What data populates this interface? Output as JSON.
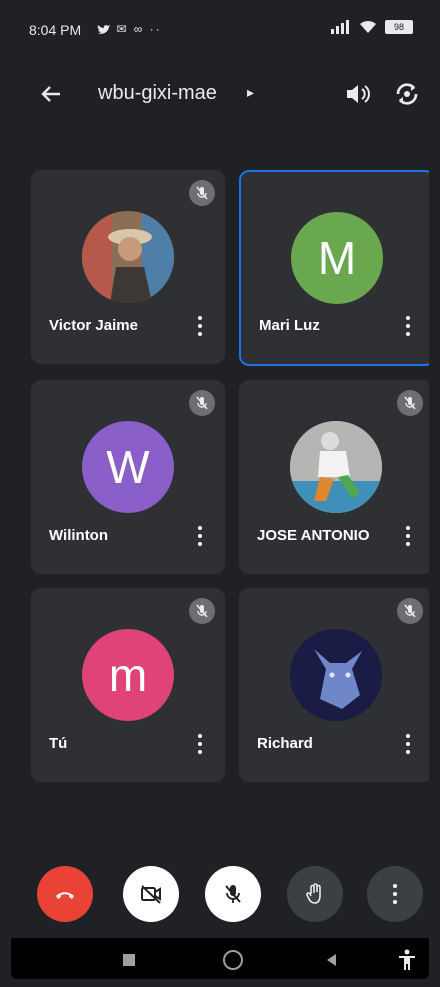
{
  "status_bar": {
    "time": "8:04 PM",
    "left_icons": "✉ ∞ ··",
    "battery": "98"
  },
  "top_bar": {
    "meeting_code": "wbu-gixi-mae",
    "caret": "▸"
  },
  "participants": [
    {
      "name": "Victor Jaime",
      "avatar_type": "photo",
      "muted": true,
      "active": false
    },
    {
      "name": "Mari Luz",
      "avatar_letter": "M",
      "avatar_color": "#6aa84f",
      "muted": false,
      "active": true
    },
    {
      "name": "Wilinton",
      "avatar_letter": "W",
      "avatar_color": "#8b5fc9",
      "muted": true,
      "active": false
    },
    {
      "name": "JOSE ANTONIO",
      "avatar_type": "photo",
      "muted": true,
      "active": false
    },
    {
      "name": "Tú",
      "avatar_letter": "m",
      "avatar_color": "#e04377",
      "muted": true,
      "active": false
    },
    {
      "name": "Richard",
      "avatar_type": "photo",
      "muted": true,
      "active": false
    }
  ],
  "controls": {
    "end_call_color": "#ea4335",
    "accent": "#1a73e8"
  }
}
